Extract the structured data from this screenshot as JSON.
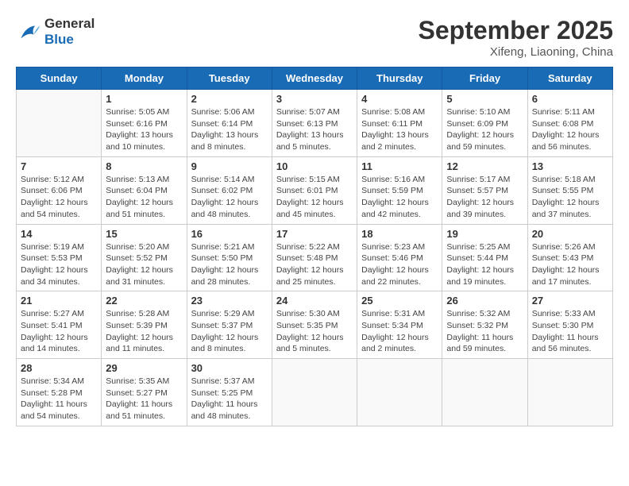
{
  "header": {
    "logo_line1": "General",
    "logo_line2": "Blue",
    "month": "September 2025",
    "location": "Xifeng, Liaoning, China"
  },
  "days_of_week": [
    "Sunday",
    "Monday",
    "Tuesday",
    "Wednesday",
    "Thursday",
    "Friday",
    "Saturday"
  ],
  "weeks": [
    [
      {
        "day": "",
        "info": ""
      },
      {
        "day": "1",
        "info": "Sunrise: 5:05 AM\nSunset: 6:16 PM\nDaylight: 13 hours\nand 10 minutes."
      },
      {
        "day": "2",
        "info": "Sunrise: 5:06 AM\nSunset: 6:14 PM\nDaylight: 13 hours\nand 8 minutes."
      },
      {
        "day": "3",
        "info": "Sunrise: 5:07 AM\nSunset: 6:13 PM\nDaylight: 13 hours\nand 5 minutes."
      },
      {
        "day": "4",
        "info": "Sunrise: 5:08 AM\nSunset: 6:11 PM\nDaylight: 13 hours\nand 2 minutes."
      },
      {
        "day": "5",
        "info": "Sunrise: 5:10 AM\nSunset: 6:09 PM\nDaylight: 12 hours\nand 59 minutes."
      },
      {
        "day": "6",
        "info": "Sunrise: 5:11 AM\nSunset: 6:08 PM\nDaylight: 12 hours\nand 56 minutes."
      }
    ],
    [
      {
        "day": "7",
        "info": "Sunrise: 5:12 AM\nSunset: 6:06 PM\nDaylight: 12 hours\nand 54 minutes."
      },
      {
        "day": "8",
        "info": "Sunrise: 5:13 AM\nSunset: 6:04 PM\nDaylight: 12 hours\nand 51 minutes."
      },
      {
        "day": "9",
        "info": "Sunrise: 5:14 AM\nSunset: 6:02 PM\nDaylight: 12 hours\nand 48 minutes."
      },
      {
        "day": "10",
        "info": "Sunrise: 5:15 AM\nSunset: 6:01 PM\nDaylight: 12 hours\nand 45 minutes."
      },
      {
        "day": "11",
        "info": "Sunrise: 5:16 AM\nSunset: 5:59 PM\nDaylight: 12 hours\nand 42 minutes."
      },
      {
        "day": "12",
        "info": "Sunrise: 5:17 AM\nSunset: 5:57 PM\nDaylight: 12 hours\nand 39 minutes."
      },
      {
        "day": "13",
        "info": "Sunrise: 5:18 AM\nSunset: 5:55 PM\nDaylight: 12 hours\nand 37 minutes."
      }
    ],
    [
      {
        "day": "14",
        "info": "Sunrise: 5:19 AM\nSunset: 5:53 PM\nDaylight: 12 hours\nand 34 minutes."
      },
      {
        "day": "15",
        "info": "Sunrise: 5:20 AM\nSunset: 5:52 PM\nDaylight: 12 hours\nand 31 minutes."
      },
      {
        "day": "16",
        "info": "Sunrise: 5:21 AM\nSunset: 5:50 PM\nDaylight: 12 hours\nand 28 minutes."
      },
      {
        "day": "17",
        "info": "Sunrise: 5:22 AM\nSunset: 5:48 PM\nDaylight: 12 hours\nand 25 minutes."
      },
      {
        "day": "18",
        "info": "Sunrise: 5:23 AM\nSunset: 5:46 PM\nDaylight: 12 hours\nand 22 minutes."
      },
      {
        "day": "19",
        "info": "Sunrise: 5:25 AM\nSunset: 5:44 PM\nDaylight: 12 hours\nand 19 minutes."
      },
      {
        "day": "20",
        "info": "Sunrise: 5:26 AM\nSunset: 5:43 PM\nDaylight: 12 hours\nand 17 minutes."
      }
    ],
    [
      {
        "day": "21",
        "info": "Sunrise: 5:27 AM\nSunset: 5:41 PM\nDaylight: 12 hours\nand 14 minutes."
      },
      {
        "day": "22",
        "info": "Sunrise: 5:28 AM\nSunset: 5:39 PM\nDaylight: 12 hours\nand 11 minutes."
      },
      {
        "day": "23",
        "info": "Sunrise: 5:29 AM\nSunset: 5:37 PM\nDaylight: 12 hours\nand 8 minutes."
      },
      {
        "day": "24",
        "info": "Sunrise: 5:30 AM\nSunset: 5:35 PM\nDaylight: 12 hours\nand 5 minutes."
      },
      {
        "day": "25",
        "info": "Sunrise: 5:31 AM\nSunset: 5:34 PM\nDaylight: 12 hours\nand 2 minutes."
      },
      {
        "day": "26",
        "info": "Sunrise: 5:32 AM\nSunset: 5:32 PM\nDaylight: 11 hours\nand 59 minutes."
      },
      {
        "day": "27",
        "info": "Sunrise: 5:33 AM\nSunset: 5:30 PM\nDaylight: 11 hours\nand 56 minutes."
      }
    ],
    [
      {
        "day": "28",
        "info": "Sunrise: 5:34 AM\nSunset: 5:28 PM\nDaylight: 11 hours\nand 54 minutes."
      },
      {
        "day": "29",
        "info": "Sunrise: 5:35 AM\nSunset: 5:27 PM\nDaylight: 11 hours\nand 51 minutes."
      },
      {
        "day": "30",
        "info": "Sunrise: 5:37 AM\nSunset: 5:25 PM\nDaylight: 11 hours\nand 48 minutes."
      },
      {
        "day": "",
        "info": ""
      },
      {
        "day": "",
        "info": ""
      },
      {
        "day": "",
        "info": ""
      },
      {
        "day": "",
        "info": ""
      }
    ]
  ]
}
